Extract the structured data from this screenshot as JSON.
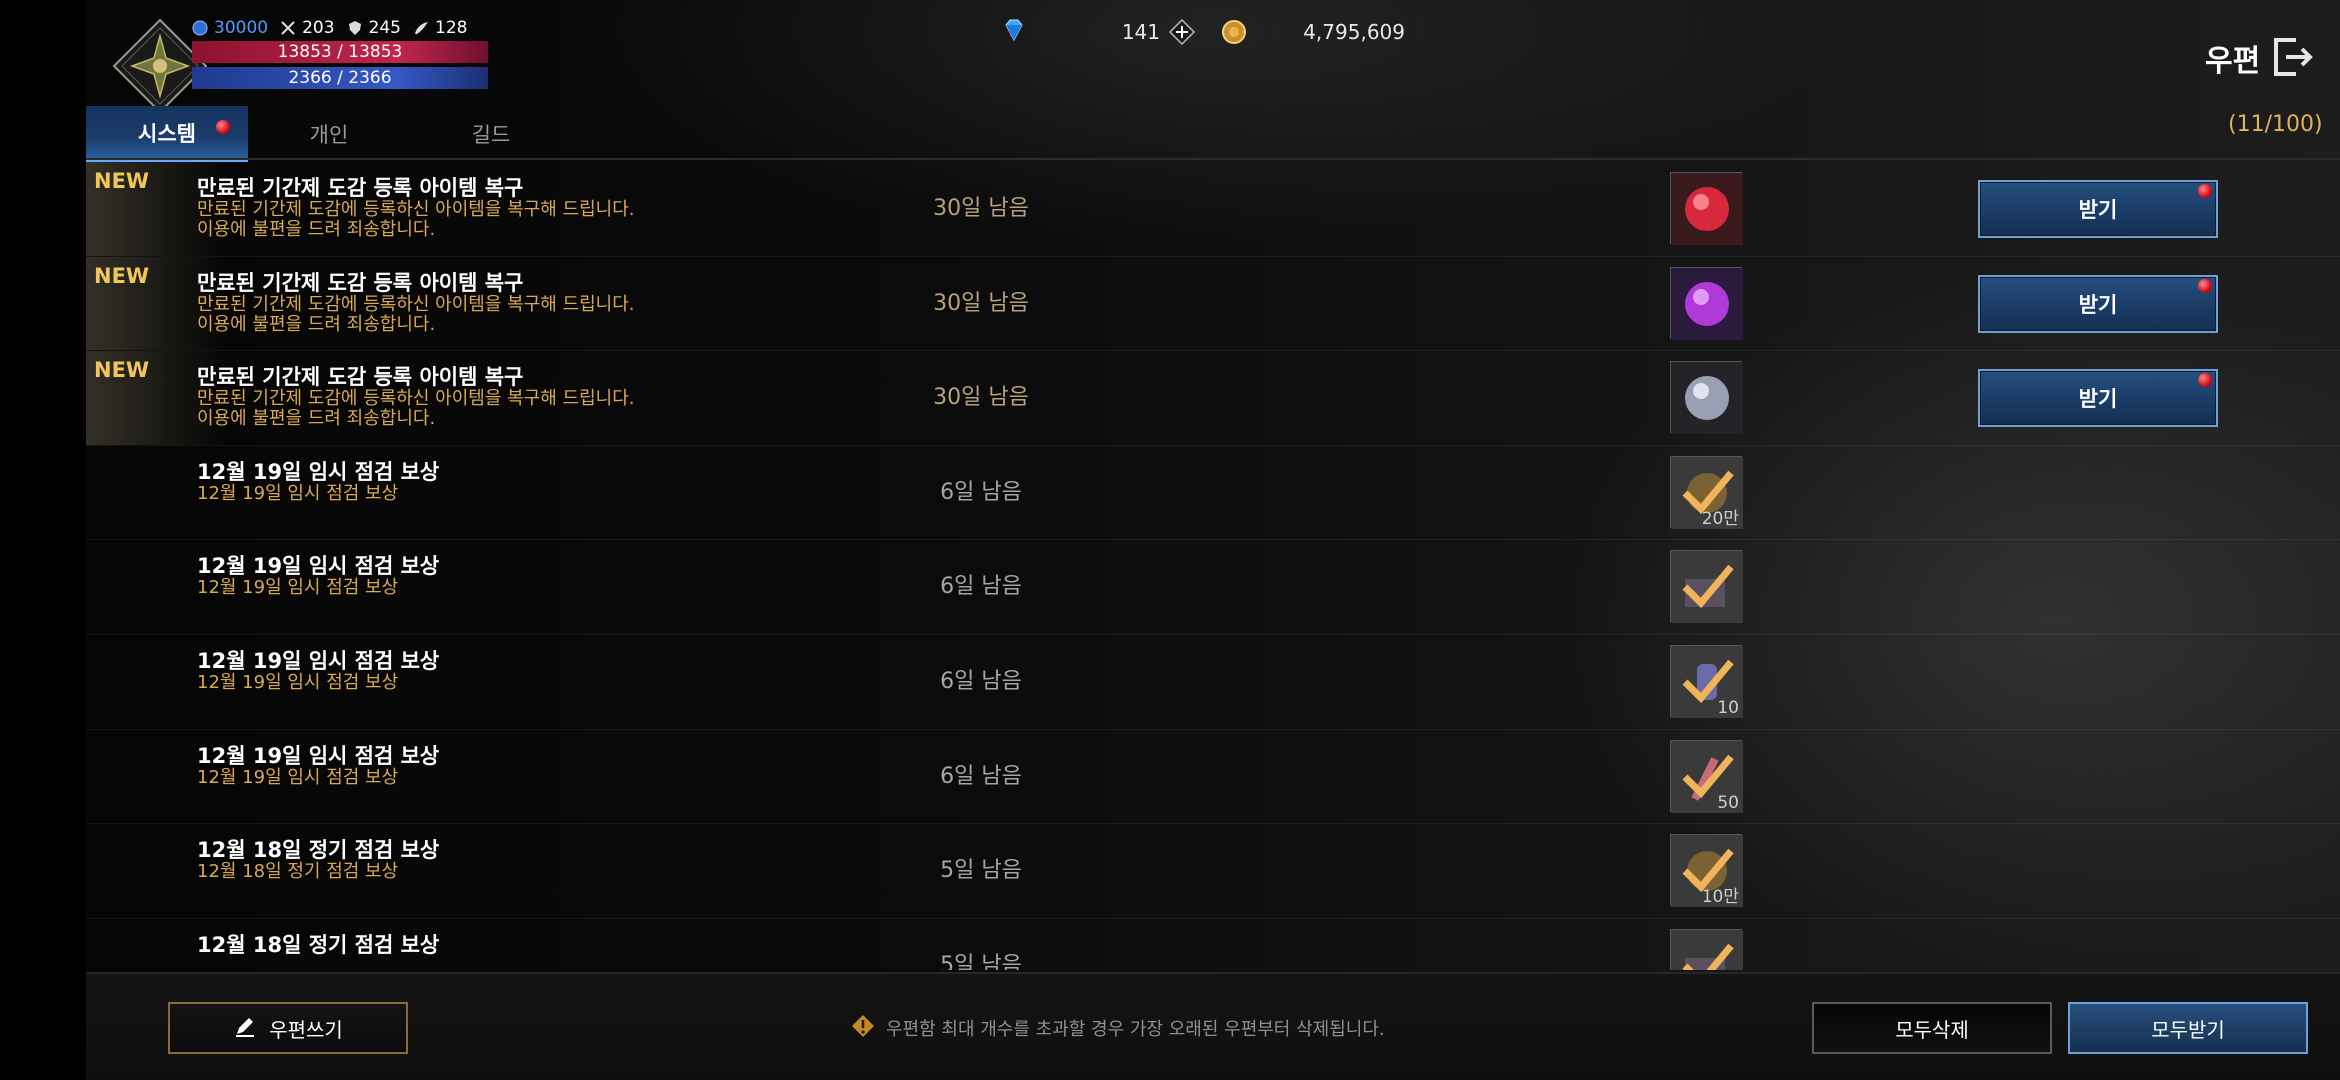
{
  "status": {
    "blue_stat": "30000",
    "attack_stat": "203",
    "defense_stat": "245",
    "speed_stat": "128",
    "hp": "13853 / 13853",
    "mp": "2366 / 2366"
  },
  "currency": {
    "diamonds": "141",
    "gold": "4,795,609"
  },
  "header": {
    "title": "우편",
    "count": "(11/100)"
  },
  "tabs": [
    {
      "label": "시스템",
      "active": true,
      "has_dot": true
    },
    {
      "label": "개인",
      "active": false
    },
    {
      "label": "길드",
      "active": false
    }
  ],
  "mails": [
    {
      "new": "NEW",
      "title": "만료된 기간제 도감 등록 아이템 복구",
      "desc1": "만료된 기간제 도감에 등록하신 아이템을 복구해 드립니다.",
      "desc2": "이용에 불편을 드려 죄송합니다.",
      "days": "30일 남음",
      "item": "red-orb-icon",
      "qty": "",
      "button": "받기"
    },
    {
      "new": "NEW",
      "title": "만료된 기간제 도감 등록 아이템 복구",
      "desc1": "만료된 기간제 도감에 등록하신 아이템을 복구해 드립니다.",
      "desc2": "이용에 불편을 드려 죄송합니다.",
      "days": "30일 남음",
      "item": "purple-orb-icon",
      "qty": "",
      "button": "받기"
    },
    {
      "new": "NEW",
      "title": "만료된 기간제 도감 등록 아이템 복구",
      "desc1": "만료된 기간제 도감에 등록하신 아이템을 복구해 드립니다.",
      "desc2": "이용에 불편을 드려 죄송합니다.",
      "days": "30일 남음",
      "item": "silver-orb-icon",
      "qty": "",
      "button": "받기"
    },
    {
      "new": "",
      "title": "12월 19일 임시 점검 보상",
      "desc1": "12월 19일 임시 점검 보상",
      "desc2": "",
      "days": "6일 남음",
      "item": "gold-coin-claimed-icon",
      "qty": "20만",
      "button": ""
    },
    {
      "new": "",
      "title": "12월 19일 임시 점검 보상",
      "desc1": "12월 19일 임시 점검 보상",
      "desc2": "",
      "days": "6일 남음",
      "item": "item-claimed-icon",
      "qty": "",
      "button": ""
    },
    {
      "new": "",
      "title": "12월 19일 임시 점검 보상",
      "desc1": "12월 19일 임시 점검 보상",
      "desc2": "",
      "days": "6일 남음",
      "item": "potion-claimed-icon",
      "qty": "10",
      "button": ""
    },
    {
      "new": "",
      "title": "12월 19일 임시 점검 보상",
      "desc1": "12월 19일 임시 점검 보상",
      "desc2": "",
      "days": "6일 남음",
      "item": "candy-claimed-icon",
      "qty": "50",
      "button": ""
    },
    {
      "new": "",
      "title": "12월 18일 정기 점검 보상",
      "desc1": "12월 18일 정기 점검 보상",
      "desc2": "",
      "days": "5일 남음",
      "item": "gold-coin-claimed-icon",
      "qty": "10만",
      "button": ""
    },
    {
      "new": "",
      "title": "12월 18일 정기 점검 보상",
      "desc1": "",
      "desc2": "",
      "days": "5일 남음",
      "item": "item-claimed-icon",
      "qty": "",
      "button": ""
    }
  ],
  "footer": {
    "write_label": "우편쓰기",
    "notice": "우편함 최대 개수를 초과할 경우 가장 오래된 우편부터 삭제됩니다.",
    "delete_all_label": "모두삭제",
    "claim_all_label": "모두받기"
  },
  "colors": {
    "accent_blue": "#6f9fd6",
    "gold_text": "#d8a957",
    "new_badge": "#f1c75b",
    "notify_red": "#d40e1c"
  }
}
